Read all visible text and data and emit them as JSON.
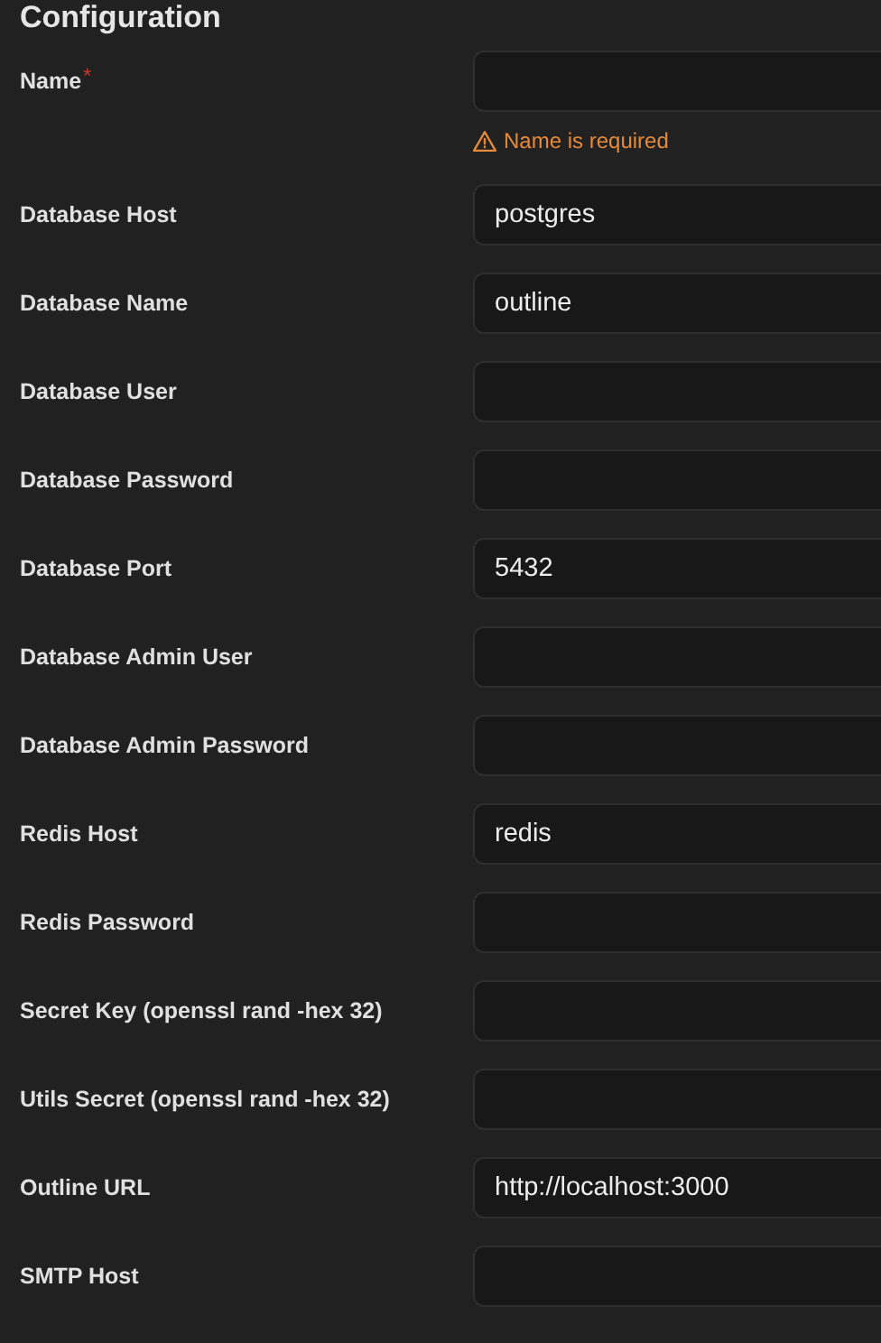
{
  "title": "Configuration",
  "fields": [
    {
      "label": "Name",
      "required_mark": "*",
      "error": "Name is required"
    },
    {
      "label": "Database Host",
      "value": "postgres"
    },
    {
      "label": "Database Name",
      "value": "outline"
    },
    {
      "label": "Database User"
    },
    {
      "label": "Database Password"
    },
    {
      "label": "Database Port",
      "value": "5432"
    },
    {
      "label": "Database Admin User"
    },
    {
      "label": "Database Admin Password"
    },
    {
      "label": "Redis Host",
      "value": "redis"
    },
    {
      "label": "Redis Password"
    },
    {
      "label": "Secret Key (openssl rand -hex 32)"
    },
    {
      "label": "Utils Secret (openssl rand -hex 32)"
    },
    {
      "label": "Outline URL",
      "value": "http://localhost:3000"
    },
    {
      "label": "SMTP Host"
    }
  ]
}
